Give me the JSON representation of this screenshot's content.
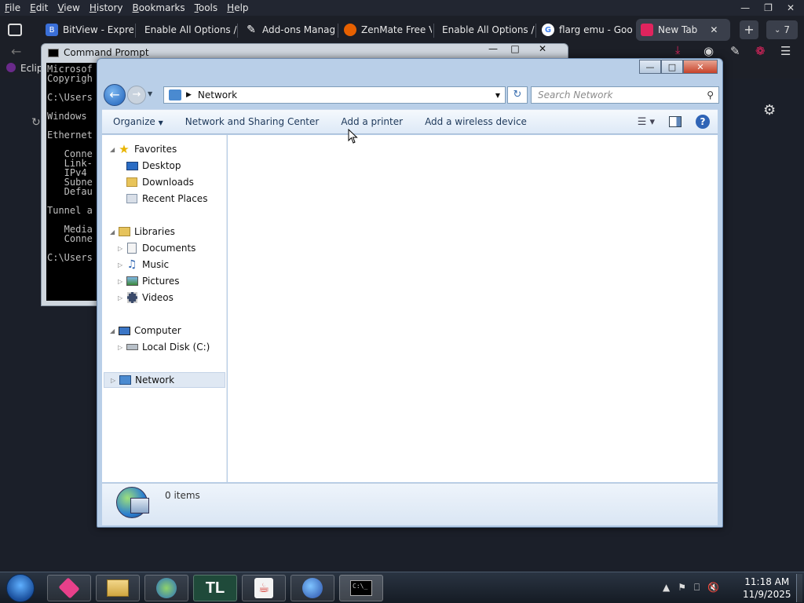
{
  "browser": {
    "menu": [
      "File",
      "Edit",
      "View",
      "History",
      "Bookmarks",
      "Tools",
      "Help"
    ],
    "tabs": [
      {
        "title": "BitView - Express",
        "icon": "bitview-icon",
        "color": "#3a6fd8"
      },
      {
        "title": "Enable All Options /",
        "icon": "page-icon",
        "color": "#555"
      },
      {
        "title": "Add-ons Manag",
        "icon": "puzzle-icon",
        "color": "#777"
      },
      {
        "title": "ZenMate Free VI",
        "icon": "firefox-icon",
        "color": "#e66000"
      },
      {
        "title": "Enable All Options /",
        "icon": "page-icon",
        "color": "#555"
      },
      {
        "title": "flarg emu - Goo",
        "icon": "google-icon",
        "color": "#4285f4"
      },
      {
        "title": "New Tab",
        "icon": "newtab-icon",
        "color": "#e0245e"
      }
    ],
    "tab_count": "7",
    "bookmark_item": "Eclip"
  },
  "cmd": {
    "title": "Command Prompt",
    "lines": [
      "Microsof",
      "Copyrigh",
      "",
      "C:\\Users",
      "",
      "Windows ",
      "",
      "Ethernet",
      "",
      "   Conne",
      "   Link-",
      "   IPv4 ",
      "   Subne",
      "   Defau",
      "",
      "Tunnel a",
      "",
      "   Media",
      "   Conne",
      "",
      "C:\\Users"
    ]
  },
  "explorer": {
    "address": "Network",
    "search_placeholder": "Search Network",
    "toolbar": {
      "organize": "Organize",
      "network_sharing": "Network and Sharing Center",
      "add_printer": "Add a printer",
      "add_wireless": "Add a wireless device"
    },
    "nav": {
      "favorites": "Favorites",
      "desktop": "Desktop",
      "downloads": "Downloads",
      "recent": "Recent Places",
      "libraries": "Libraries",
      "documents": "Documents",
      "music": "Music",
      "pictures": "Pictures",
      "videos": "Videos",
      "computer": "Computer",
      "local_disk": "Local Disk (C:)",
      "network": "Network"
    },
    "status": "0 items"
  },
  "taskbar": {
    "time": "11:18 AM",
    "date": "11/9/2025",
    "apps": [
      "start-orb-icon",
      "pink-app-icon",
      "file-explorer-icon",
      "network-globe-icon",
      "tl-app-icon",
      "java-icon",
      "browser-globe-icon",
      "command-prompt-icon"
    ]
  }
}
